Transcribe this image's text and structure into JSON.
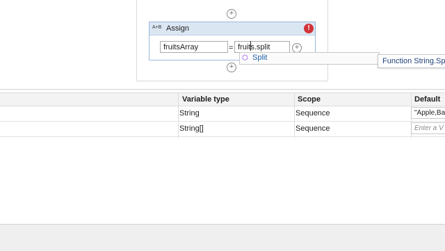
{
  "activity": {
    "title": "Assign",
    "icon_text": "A+B",
    "error_glyph": "!",
    "to_value": "fruitsArray",
    "equals": "=",
    "value_text": "fruits.split",
    "add_glyph": "+"
  },
  "autocomplete": {
    "items": [
      {
        "label": "Split",
        "icon": "method-cube-icon"
      }
    ]
  },
  "tooltip": {
    "text": "Function String.Split"
  },
  "variables_panel": {
    "columns": [
      "Variable type",
      "Scope",
      "Default"
    ],
    "rows": [
      {
        "type": "String",
        "scope": "Sequence",
        "default": "\"Apple,Ba"
      },
      {
        "type": "String[]",
        "scope": "Sequence",
        "default_placeholder": "Enter a V"
      }
    ]
  }
}
